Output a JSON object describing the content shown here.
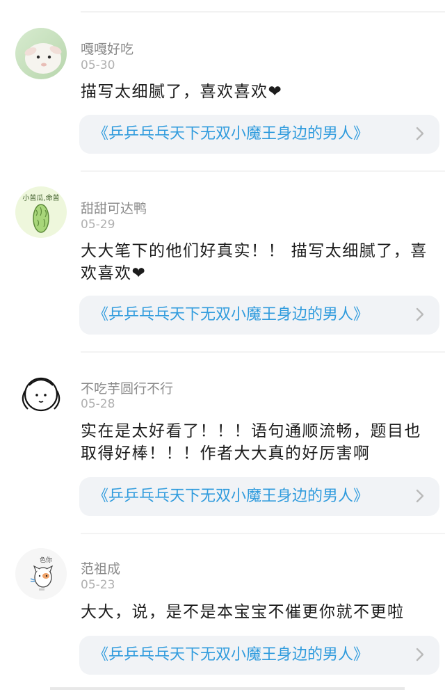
{
  "comments": [
    {
      "username": "嘎嘎好吃",
      "date": "05-30",
      "text": "描写太细腻了，喜欢喜欢❤",
      "link_title": "《乒乒乓乓天下无双小魔王身边的男人》",
      "avatar": "lamb-photo-avatar"
    },
    {
      "username": "甜甜可达鸭",
      "date": "05-29",
      "text": "大大笔下的他们好真实！！ 描写太细腻了，喜欢喜欢❤",
      "link_title": "《乒乒乓乓天下无双小魔王身边的男人》",
      "avatar": "bitter-melon-avatar",
      "avatar_text": "小苦瓜,命苦"
    },
    {
      "username": "不吃芋圆行不行",
      "date": "05-28",
      "text": "实在是太好看了！！！语句通顺流畅，题目也取得好棒！！！作者大大真的好厉害啊",
      "link_title": "《乒乒乓乓天下无双小魔王身边的男人》",
      "avatar": "doodle-girl-avatar"
    },
    {
      "username": "范祖成",
      "date": "05-23",
      "text": "大大，说，是不是本宝宝不催更你就不更啦",
      "link_title": "《乒乒乓乓天下无双小魔王身边的男人》",
      "avatar": "doodle-cat-avatar",
      "avatar_text": "色你"
    }
  ],
  "colors": {
    "link": "#2f9bdd",
    "card_bg": "#f1f3f6",
    "meta": "#8a8a8a"
  }
}
